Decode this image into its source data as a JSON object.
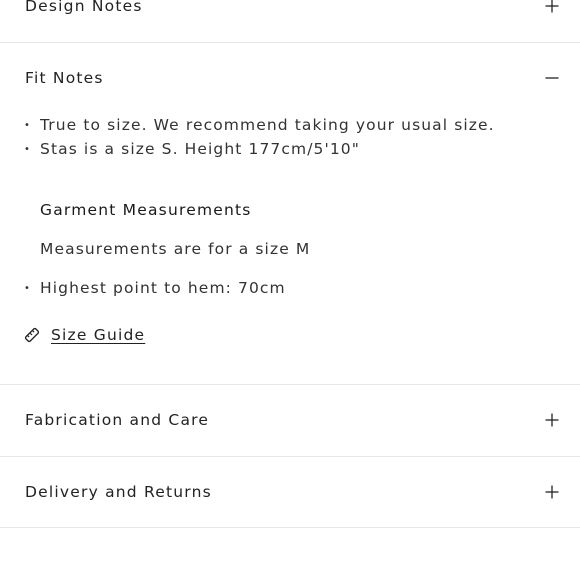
{
  "accordion": {
    "design_notes": {
      "title": "Design Notes",
      "expanded": false,
      "icon": "plus-icon"
    },
    "fit_notes": {
      "title": "Fit Notes",
      "expanded": true,
      "icon": "minus-icon",
      "bullets": [
        "True to size. We recommend taking your usual size.",
        "Stas is a size S. Height 177cm/5'10\""
      ],
      "garment_heading": "Garment Measurements",
      "measurement_note": "Measurements are for a size M",
      "measurement_bullets": [
        "Highest point to hem: 70cm"
      ],
      "size_guide_label": "Size Guide",
      "size_guide_icon": "ruler-icon"
    },
    "fabrication": {
      "title": "Fabrication and Care",
      "expanded": false,
      "icon": "plus-icon"
    },
    "delivery": {
      "title": "Delivery and Returns",
      "expanded": false,
      "icon": "plus-icon"
    }
  },
  "bullet_glyph": "•"
}
